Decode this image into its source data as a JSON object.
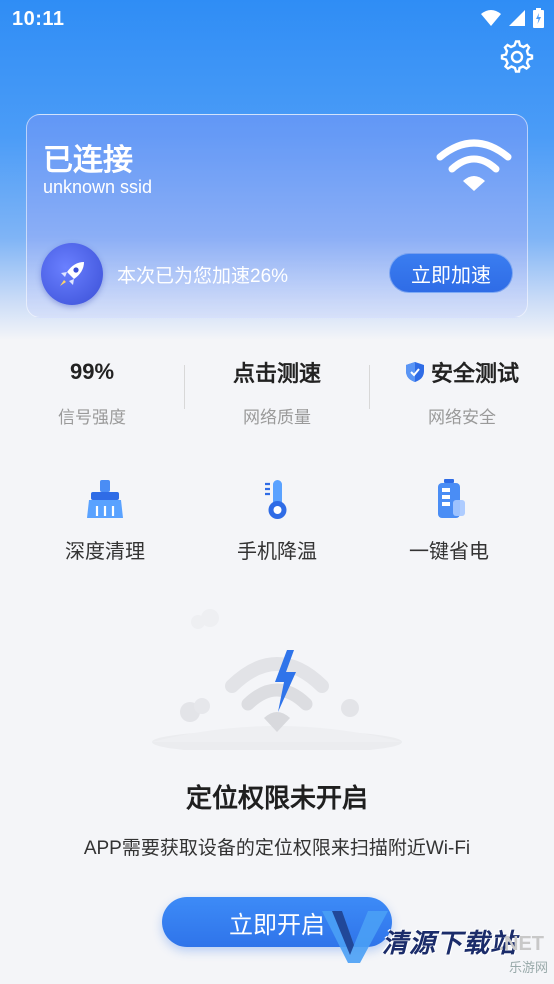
{
  "status_bar": {
    "time": "10:11"
  },
  "card": {
    "title": "已连接",
    "ssid": "unknown ssid",
    "boost_text": "本次已为您加速26%",
    "boost_button": "立即加速"
  },
  "stats": [
    {
      "value": "99%",
      "label": "信号强度"
    },
    {
      "value": "点击测速",
      "label": "网络质量"
    },
    {
      "value": "安全测试",
      "label": "网络安全"
    }
  ],
  "tools": [
    {
      "label": "深度清理",
      "icon": "broom-icon"
    },
    {
      "label": "手机降温",
      "icon": "thermometer-icon"
    },
    {
      "label": "一键省电",
      "icon": "battery-icon"
    }
  ],
  "permission": {
    "title": "定位权限未开启",
    "description": "APP需要获取设备的定位权限来扫描附近Wi-Fi",
    "button": "立即开启"
  },
  "watermark": {
    "name": "清源下载站",
    "net": ".NET",
    "sub": "乐游网"
  },
  "colors": {
    "primary": "#2f74ea",
    "hero": "#2f8df5",
    "text": "#222222",
    "muted": "#9a9a9a"
  }
}
